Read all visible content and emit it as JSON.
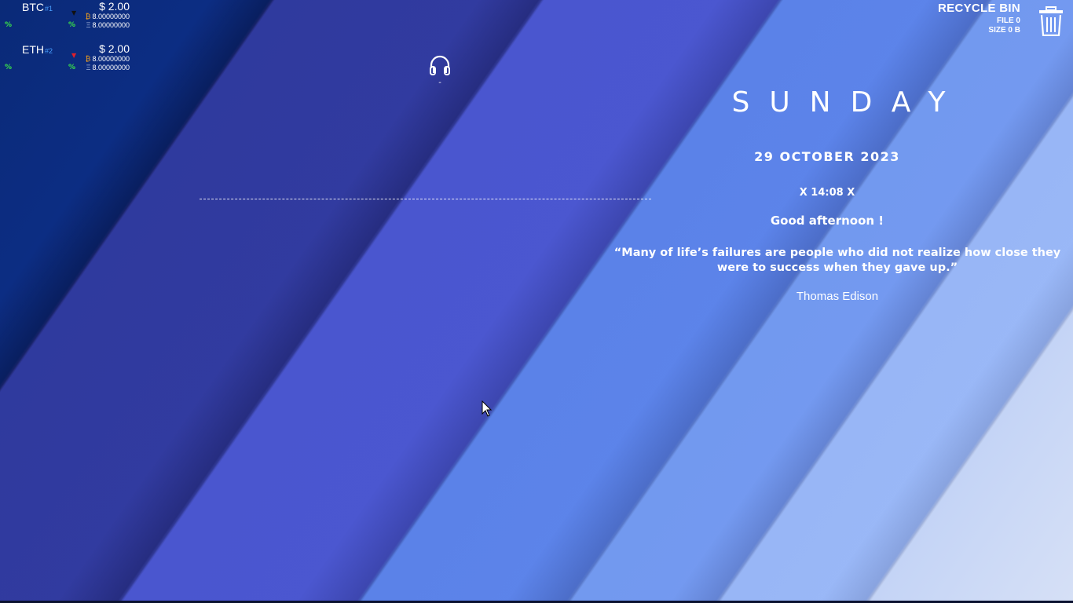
{
  "crypto": {
    "coins": [
      {
        "symbol": "BTC",
        "rank": "#1",
        "arrow": "▼",
        "arrow_color": "#111111",
        "price": "$ 2.00",
        "holding_btc": "8.00000000",
        "holding_eth": "8.00000000",
        "pct_left": "%",
        "pct_right": "%"
      },
      {
        "symbol": "ETH",
        "rank": "#2",
        "arrow": "▼",
        "arrow_color": "#e0202a",
        "price": "$ 2.00",
        "holding_btc": "8.00000000",
        "holding_eth": "8.00000000",
        "pct_left": "%",
        "pct_right": "%"
      }
    ],
    "btc_glyph": "₿",
    "eth_glyph": "Ξ"
  },
  "music": {
    "icon": "headphones-icon",
    "track": "-"
  },
  "recycle_bin": {
    "title": "RECYCLE BIN",
    "file": "FILE 0",
    "size": "SIZE 0 B",
    "icon": "trash-icon"
  },
  "clock": {
    "day": "SUNDAY",
    "date": "29  OCTOBER  2023",
    "time": "X 14:08 X",
    "greeting": "Good afternoon !"
  },
  "quote": {
    "text": "“Many of life’s failures are people who did not realize how close they were to success when they gave up.”",
    "author": "Thomas Edison"
  },
  "colors": {
    "positive": "#39e04a",
    "rank": "#49a0ff",
    "btc": "#f7a21a"
  }
}
